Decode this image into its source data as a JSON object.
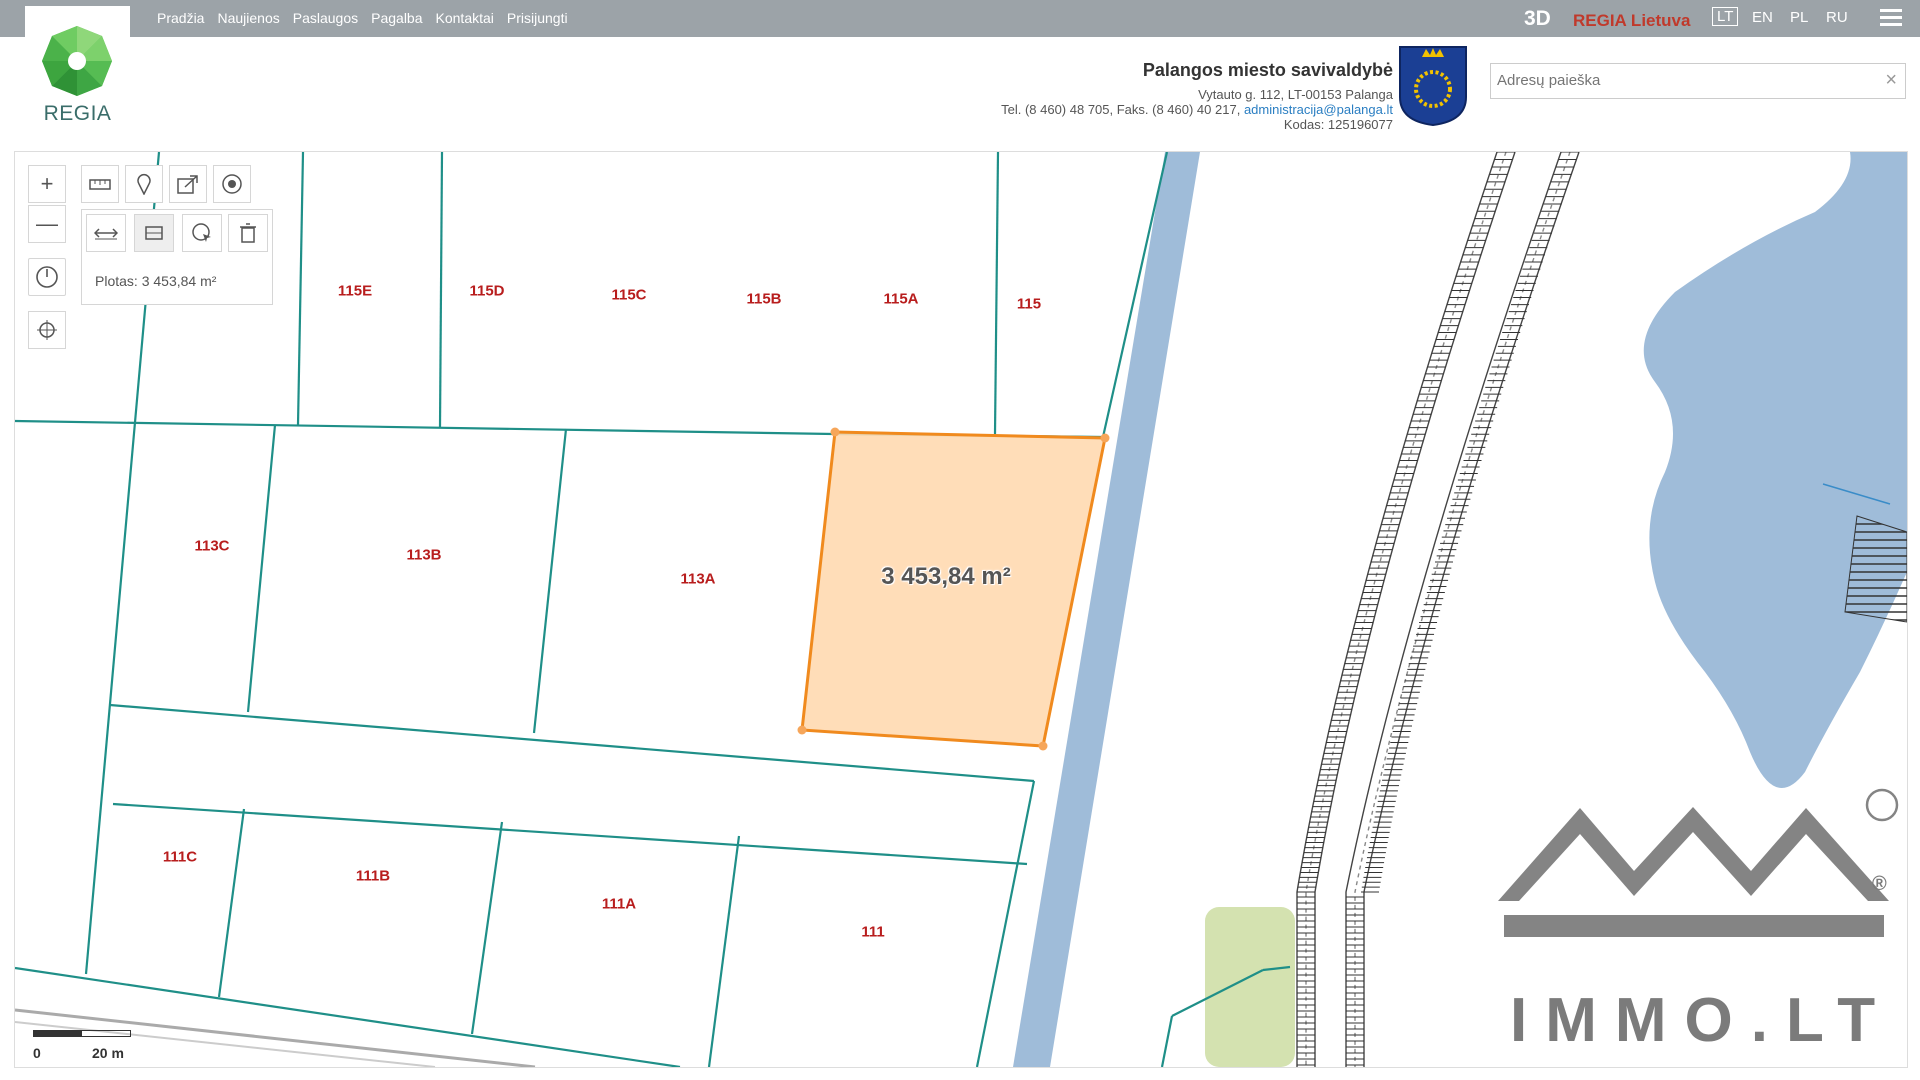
{
  "nav": {
    "items": [
      "Pradžia",
      "Naujienos",
      "Paslaugos",
      "Pagalba",
      "Kontaktai",
      "Prisijungti"
    ]
  },
  "topright": {
    "three_d": "3D",
    "regia": "REGIA Lietuva",
    "langs": [
      "LT",
      "EN",
      "PL",
      "RU"
    ],
    "active_lang": "LT"
  },
  "logo": {
    "text": "REGIA"
  },
  "muni": {
    "title": "Palangos miesto savivaldybė",
    "address": "Vytauto g. 112, LT-00153 Palanga",
    "phone": "Tel. (8 460) 48 705, Faks. (8 460) 40 217,",
    "email": "administracija@palanga.lt",
    "code": "Kodas: 125196077"
  },
  "search": {
    "placeholder": "Adresų paieška",
    "clear": "×"
  },
  "tools": {
    "area_text": "Plotas: 3 453,84 m²",
    "zoom_in": "+",
    "zoom_out": "—"
  },
  "map": {
    "selected_area": "3 453,84 m²",
    "plots": [
      "115E",
      "115D",
      "115C",
      "115B",
      "115A",
      "115",
      "113C",
      "113B",
      "113A",
      "111C",
      "111B",
      "111A",
      "111"
    ],
    "scale": {
      "zero": "0",
      "distance": "20 m"
    },
    "colors": {
      "parcel_line": "#1f8f88",
      "selection_fill": "#ffd9b0",
      "selection_stroke": "#f08a1e",
      "water": "#9fbcd9",
      "green": "#d4e2b0"
    }
  },
  "watermark": {
    "text": "IMMO.LT",
    "registered": "®"
  }
}
